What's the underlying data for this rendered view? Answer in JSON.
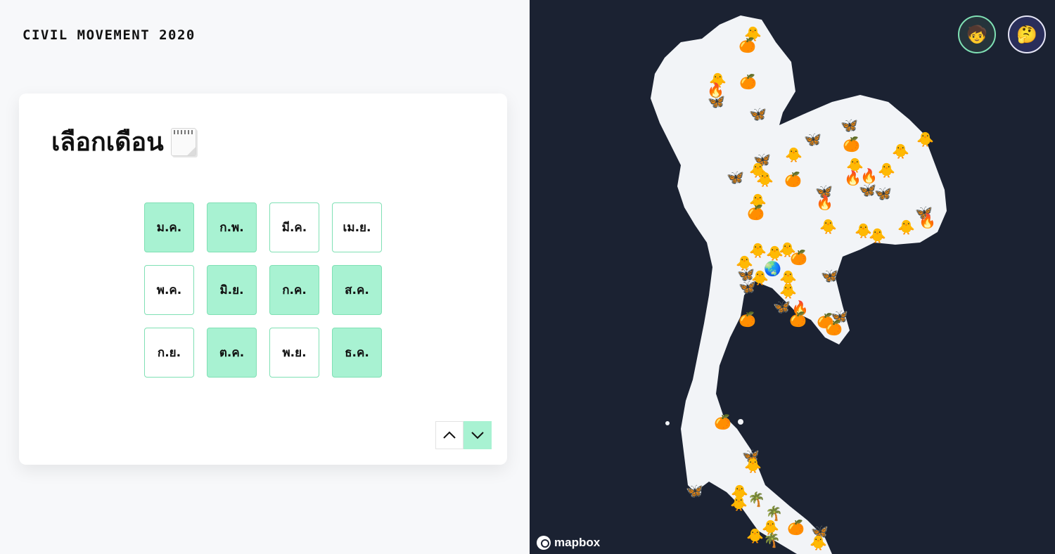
{
  "brand": "CIVIL MOVEMENT 2020",
  "card": {
    "title": "เลือกเดือน"
  },
  "months": [
    {
      "label": "ม.ค.",
      "active": true
    },
    {
      "label": "ก.พ.",
      "active": true
    },
    {
      "label": "มี.ค.",
      "active": false
    },
    {
      "label": "เม.ย.",
      "active": false
    },
    {
      "label": "พ.ค.",
      "active": false
    },
    {
      "label": "มิ.ย.",
      "active": true
    },
    {
      "label": "ก.ค.",
      "active": true
    },
    {
      "label": "ส.ค.",
      "active": true
    },
    {
      "label": "ก.ย.",
      "active": false
    },
    {
      "label": "ต.ค.",
      "active": true
    },
    {
      "label": "พ.ย.",
      "active": false
    },
    {
      "label": "ธ.ค.",
      "active": true
    }
  ],
  "colors": {
    "accent": "#a8f2d2",
    "accent_border": "#7fe0b4",
    "map_background": "#1b2232",
    "land": "#f2f4f7"
  },
  "icons": {
    "calendar": "spiral-notepad-icon",
    "nav_up": "chevron-up-icon",
    "nav_down": "chevron-down-icon",
    "chick": "🐥",
    "orange": "🍊",
    "butterfly": "🦋",
    "fire": "🔥",
    "palm": "🌴",
    "globe": "🌏",
    "avatar_1": "🧒",
    "avatar_2": "🤔"
  },
  "map": {
    "attribution": "mapbox"
  }
}
